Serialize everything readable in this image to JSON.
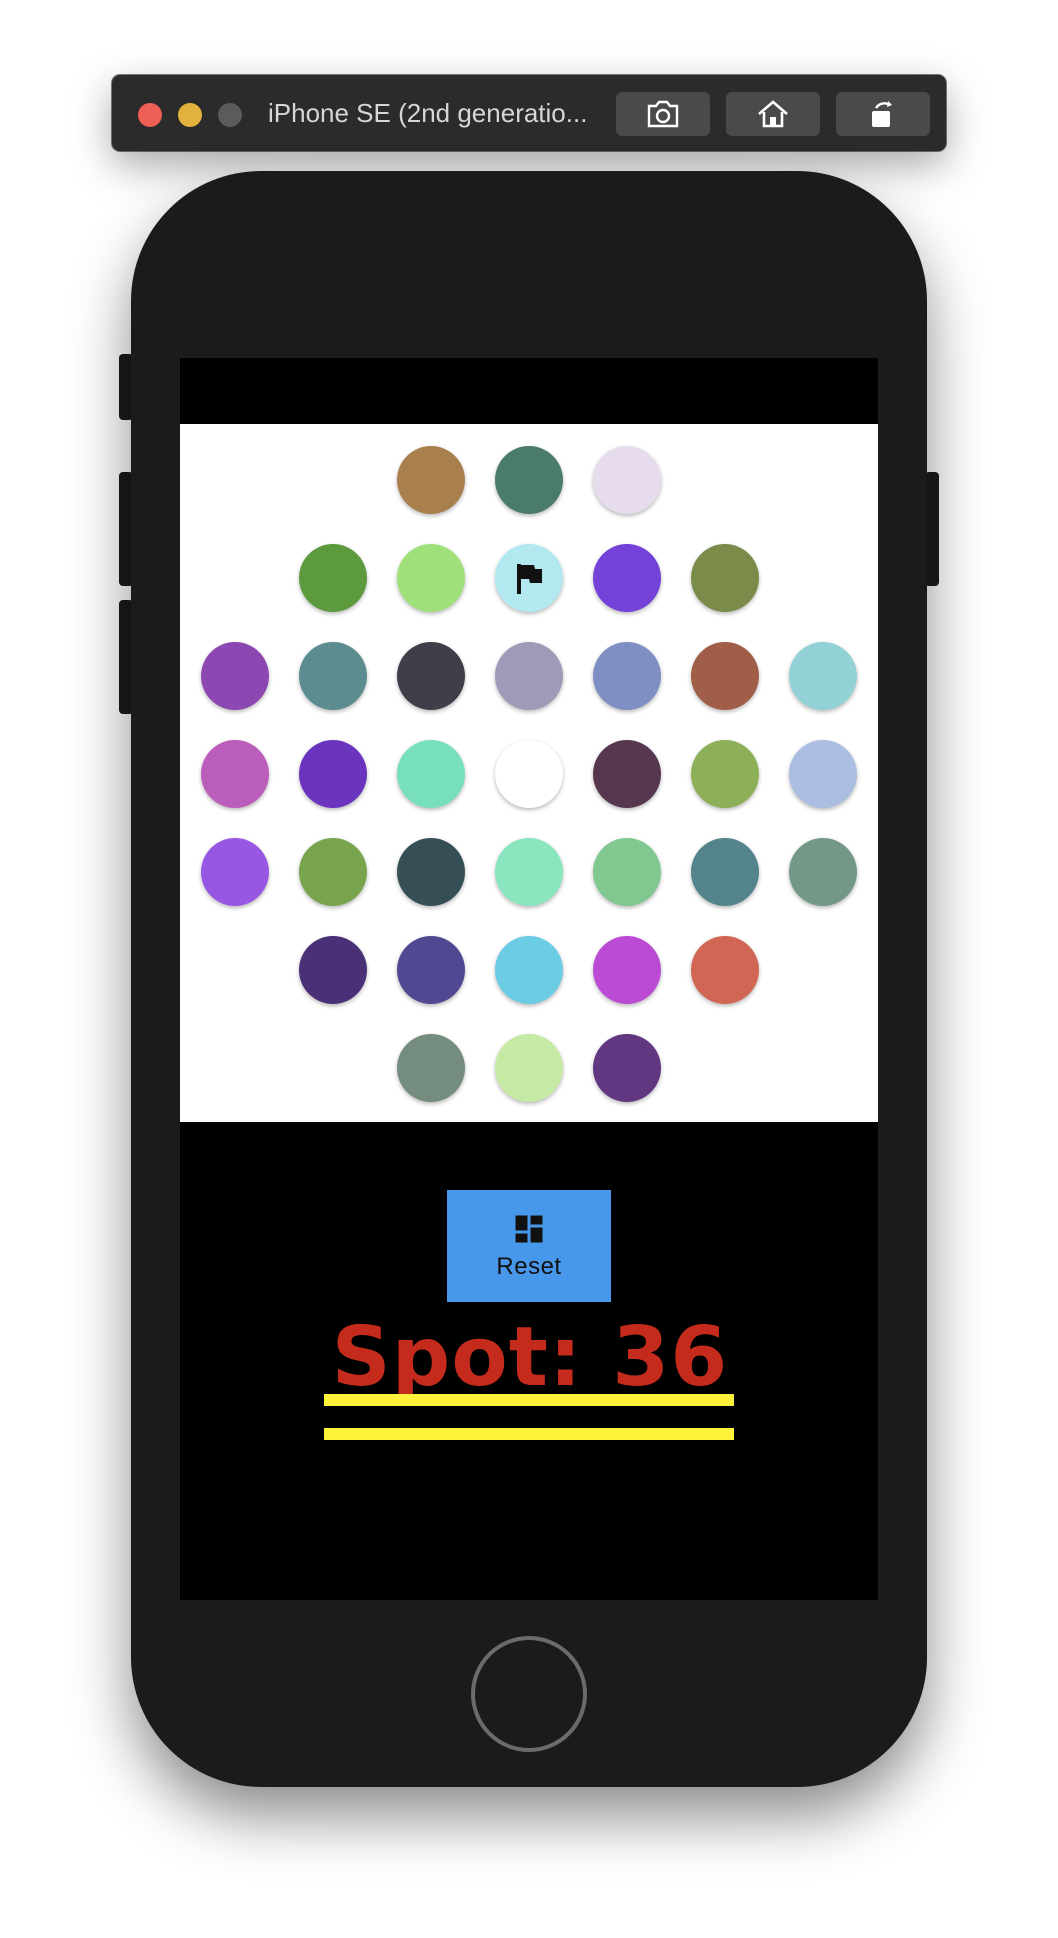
{
  "window": {
    "title": "iPhone SE (2nd generatio...",
    "buttons": [
      {
        "icon": "screenshot-icon"
      },
      {
        "icon": "home-icon"
      },
      {
        "icon": "rotate-icon"
      }
    ],
    "traffic_lights": {
      "close": "#ee5f56",
      "minimize": "#e3b23c",
      "maximize": "#5b5b5b"
    }
  },
  "board": {
    "rows": [
      [
        "#a97f4e",
        "#4a7b6b",
        "#e6dcee"
      ],
      [
        "#5c9a3d",
        "#a0e07a",
        "#b2e8ef",
        "#7441d9",
        "#7a8b4a"
      ],
      [
        "#8c47b2",
        "#5c8c8f",
        "#3f3f4a",
        "#9e9ab8",
        "#7f8fc3",
        "#a05d47",
        "#92d2d7"
      ],
      [
        "#bb5dbb",
        "#6a34bf",
        "#78dfbc",
        "#ffffff",
        "#57374f",
        "#8caf57",
        "#abbde0"
      ],
      [
        "#9757e2",
        "#78a44e",
        "#364f57",
        "#8ae6bf",
        "#80c890",
        "#53838b",
        "#749886"
      ],
      [
        "#4a3177",
        "#504890",
        "#6bcce3",
        "#bb4bd5",
        "#d06653"
      ],
      [
        "#748d7f",
        "#c6eaa4",
        "#623781"
      ]
    ],
    "flag_icon": "flag-icon",
    "flag_row": 1,
    "flag_col": 2
  },
  "reset": {
    "label": "Reset",
    "icon": "dashboard-icon",
    "color": "#4797ea"
  },
  "spot": {
    "text": "Spot: 36",
    "count": 36,
    "text_color": "#c42b1c",
    "underline_color": "#fff23a"
  }
}
